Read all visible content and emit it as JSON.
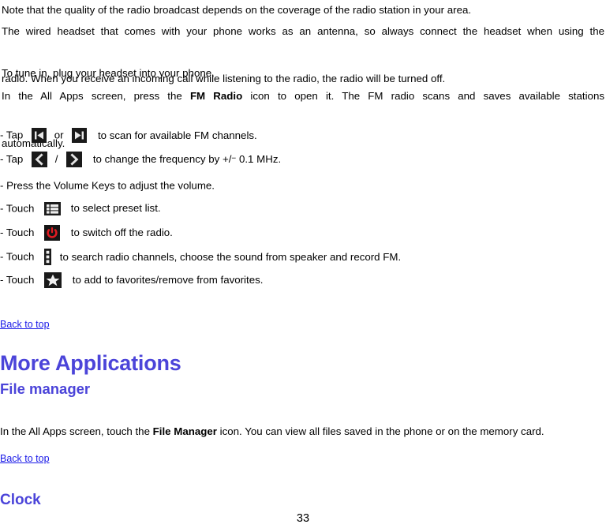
{
  "document": {
    "page_number": "33",
    "heading_color": "#4b44d9",
    "link_color": "#1a1ae8",
    "paragraphs": {
      "note": "Note that the quality of the radio broadcast depends on the coverage of the radio station in your area.",
      "antenna": "The wired headset that comes with your phone works as an antenna, so always connect the headset when using the radio. When you receive an incoming call while listening to the radio, the radio will be turned off.",
      "antenna_line1": "The wired headset that comes with your phone works as an antenna, so always connect the headset when using the",
      "antenna_line2": "radio. When you receive an incoming call while listening to the radio, the radio will be turned off.",
      "tune_in": "To tune in, plug your headset into your phone.",
      "all_apps_pre": "In the All Apps screen, press the ",
      "all_apps_bold": "FM Radio",
      "all_apps_post": " icon to open it. The FM radio scans and saves available stations",
      "all_apps_line2": "automatically."
    },
    "bullets": [
      {
        "id": "scan-channels",
        "prefix": "- Tap",
        "icon1": "skip-previous-icon",
        "separator": "or",
        "icon2": "skip-next-icon",
        "suffix": "to scan for available FM channels."
      },
      {
        "id": "change-frequency",
        "prefix": "- Tap",
        "icon1": "chevron-left-icon",
        "separator": "/",
        "icon2": "chevron-right-icon",
        "suffix_a": "to change the frequency by +/",
        "suffix_minus": "−",
        "suffix_b": " 0.1 MHz."
      },
      {
        "id": "volume-keys",
        "text": "- Press the Volume Keys to adjust the volume."
      },
      {
        "id": "preset-list",
        "prefix": "- Touch",
        "icon1": "list-icon",
        "suffix": "to select preset list."
      },
      {
        "id": "switch-off",
        "prefix": "- Touch",
        "icon1": "power-icon",
        "suffix": "to switch off the radio."
      },
      {
        "id": "search-channels",
        "prefix": "- Touch",
        "icon1": "overflow-menu-icon",
        "suffix": "to search radio channels, choose the sound from speaker and record FM."
      },
      {
        "id": "favorites",
        "prefix": "- Touch",
        "icon1": "star-icon",
        "suffix": "to add to favorites/remove from favorites."
      }
    ],
    "links": {
      "back_to_top_1": "Back to top",
      "back_to_top_2": "Back to top"
    },
    "headings": {
      "more_applications": "More Applications",
      "file_manager": "File manager",
      "clock": "Clock"
    },
    "file_manager_paragraph": {
      "pre": "In the All Apps screen, touch the ",
      "bold": "File Manager",
      "post": " icon. You can view all files saved in the phone or on the memory card."
    }
  }
}
